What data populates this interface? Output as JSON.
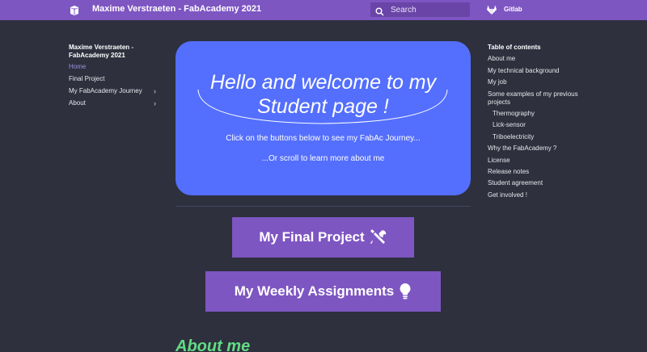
{
  "header": {
    "site_title": "Maxime Verstraeten - FabAcademy 2021",
    "search_placeholder": "Search",
    "repo_label": "Gitlab",
    "accent_color": "#7e56c2"
  },
  "left_nav": {
    "title": "Maxime Verstraeten - FabAcademy 2021",
    "items": [
      {
        "label": "Home",
        "active": true,
        "expandable": false
      },
      {
        "label": "Final Project",
        "active": false,
        "expandable": false
      },
      {
        "label": "My FabAcademy Journey",
        "active": false,
        "expandable": true
      },
      {
        "label": "About",
        "active": false,
        "expandable": true
      }
    ]
  },
  "hero": {
    "heading_line1": "Hello and welcome to my",
    "heading_line2": "Student page !",
    "subtitle1": "Click on the buttons below to see my FabAc Journey...",
    "subtitle2": "...Or scroll to learn more about me",
    "background_color": "#546ffd"
  },
  "buttons": {
    "final_project": {
      "label": "My Final Project",
      "icon": "tools-icon"
    },
    "weekly_assignments": {
      "label": "My Weekly Assignments",
      "icon": "lightbulb-icon"
    }
  },
  "about_heading": "About me",
  "toc": {
    "title": "Table of contents",
    "items": [
      {
        "label": "About me",
        "level": 1
      },
      {
        "label": "My technical background",
        "level": 1
      },
      {
        "label": "My job",
        "level": 1
      },
      {
        "label": "Some examples of my previous projects",
        "level": 1
      },
      {
        "label": "Thermography",
        "level": 2
      },
      {
        "label": "Lick-sensor",
        "level": 2
      },
      {
        "label": "Triboelectricity",
        "level": 2
      },
      {
        "label": "Why the FabAcademy ?",
        "level": 1
      },
      {
        "label": "License",
        "level": 1
      },
      {
        "label": "Release notes",
        "level": 1
      },
      {
        "label": "Student agreement",
        "level": 1
      },
      {
        "label": "Get involved !",
        "level": 1
      }
    ]
  }
}
